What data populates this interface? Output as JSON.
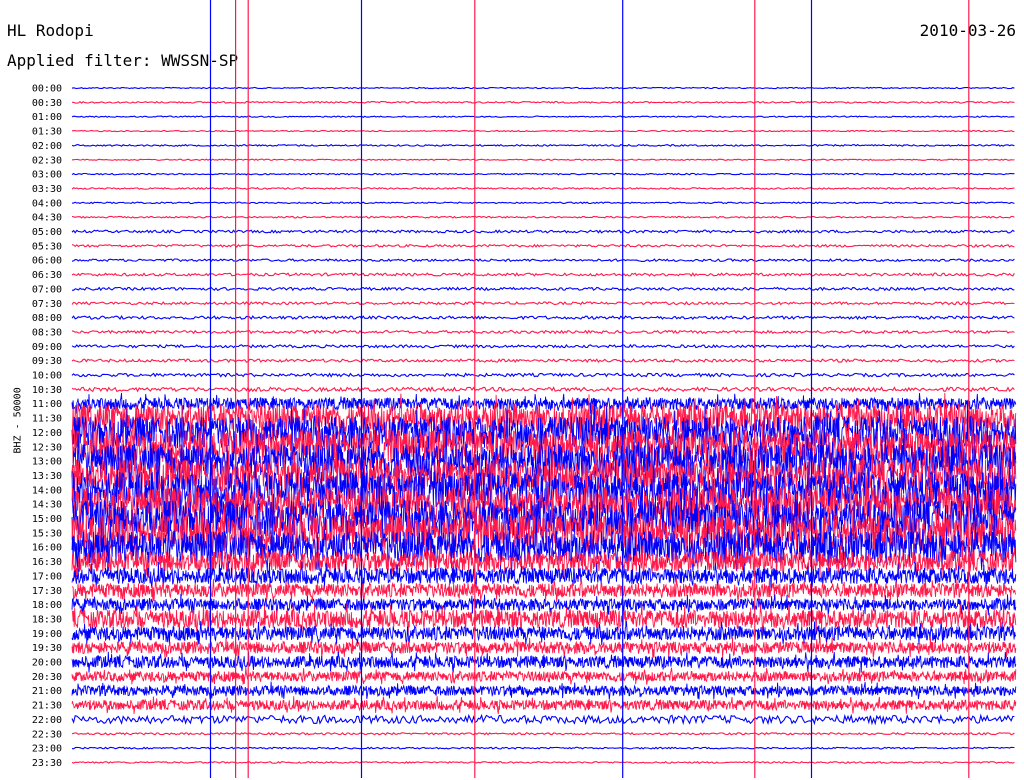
{
  "header": {
    "station": "HL Rodopi",
    "filter": "Applied filter: WWSSN-SP",
    "date": "2010-03-26"
  },
  "axis": {
    "ylabel": "BHZ - 50000"
  },
  "chart_data": {
    "type": "line",
    "title": "HL Rodopi",
    "subtitle": "Applied filter: WWSSN-SP",
    "date": "2010-03-26",
    "channel": "BHZ",
    "scale": 50000,
    "ylabel": "BHZ - 50000",
    "trace_colors": [
      "#0000ff",
      "#ff1a4b"
    ],
    "x_unit": "minutes within trace row",
    "xlim": [
      0,
      30
    ],
    "rows": [
      {
        "label": "00:00",
        "amp": 0.6
      },
      {
        "label": "00:30",
        "amp": 0.8
      },
      {
        "label": "01:00",
        "amp": 0.6
      },
      {
        "label": "01:30",
        "amp": 0.6
      },
      {
        "label": "02:00",
        "amp": 0.8
      },
      {
        "label": "02:30",
        "amp": 0.6
      },
      {
        "label": "03:00",
        "amp": 0.7
      },
      {
        "label": "03:30",
        "amp": 0.8
      },
      {
        "label": "04:00",
        "amp": 0.7
      },
      {
        "label": "04:30",
        "amp": 0.8
      },
      {
        "label": "05:00",
        "amp": 1.3
      },
      {
        "label": "05:30",
        "amp": 1.2
      },
      {
        "label": "06:00",
        "amp": 1.2
      },
      {
        "label": "06:30",
        "amp": 1.4
      },
      {
        "label": "07:00",
        "amp": 1.4
      },
      {
        "label": "07:30",
        "amp": 1.3
      },
      {
        "label": "08:00",
        "amp": 1.5
      },
      {
        "label": "08:30",
        "amp": 1.4
      },
      {
        "label": "09:00",
        "amp": 1.4
      },
      {
        "label": "09:30",
        "amp": 1.5
      },
      {
        "label": "10:00",
        "amp": 1.6
      },
      {
        "label": "10:30",
        "amp": 2.0
      },
      {
        "label": "11:00",
        "amp": 6.0
      },
      {
        "label": "11:30",
        "amp": 14.0
      },
      {
        "label": "12:00",
        "amp": 16.0
      },
      {
        "label": "12:30",
        "amp": 17.0
      },
      {
        "label": "13:00",
        "amp": 17.0
      },
      {
        "label": "13:30",
        "amp": 16.0
      },
      {
        "label": "14:00",
        "amp": 18.0
      },
      {
        "label": "14:30",
        "amp": 17.0
      },
      {
        "label": "15:00",
        "amp": 18.0
      },
      {
        "label": "15:30",
        "amp": 18.0
      },
      {
        "label": "16:00",
        "amp": 16.0
      },
      {
        "label": "16:30",
        "amp": 10.0
      },
      {
        "label": "17:00",
        "amp": 8.0
      },
      {
        "label": "17:30",
        "amp": 7.0
      },
      {
        "label": "18:00",
        "amp": 6.0
      },
      {
        "label": "18:30",
        "amp": 9.0
      },
      {
        "label": "19:00",
        "amp": 7.0
      },
      {
        "label": "19:30",
        "amp": 6.0
      },
      {
        "label": "20:00",
        "amp": 6.0
      },
      {
        "label": "20:30",
        "amp": 5.0
      },
      {
        "label": "21:00",
        "amp": 5.0
      },
      {
        "label": "21:30",
        "amp": 5.0
      },
      {
        "label": "22:00",
        "amp": 4.0
      },
      {
        "label": "22:30",
        "amp": 1.0
      },
      {
        "label": "23:00",
        "amp": 0.8
      },
      {
        "label": "23:30",
        "amp": 0.8
      }
    ],
    "spikes": [
      {
        "minute": 4.4,
        "color": "#0000ff"
      },
      {
        "minute": 5.2,
        "color": "#ff1a4b"
      },
      {
        "minute": 5.6,
        "color": "#ff1a4b"
      },
      {
        "minute": 9.2,
        "color": "#0000ff"
      },
      {
        "minute": 12.8,
        "color": "#ff1a4b"
      },
      {
        "minute": 17.5,
        "color": "#0000ff"
      },
      {
        "minute": 21.7,
        "color": "#ff1a4b"
      },
      {
        "minute": 23.5,
        "color": "#0000ff"
      },
      {
        "minute": 28.5,
        "color": "#ff1a4b"
      }
    ]
  }
}
